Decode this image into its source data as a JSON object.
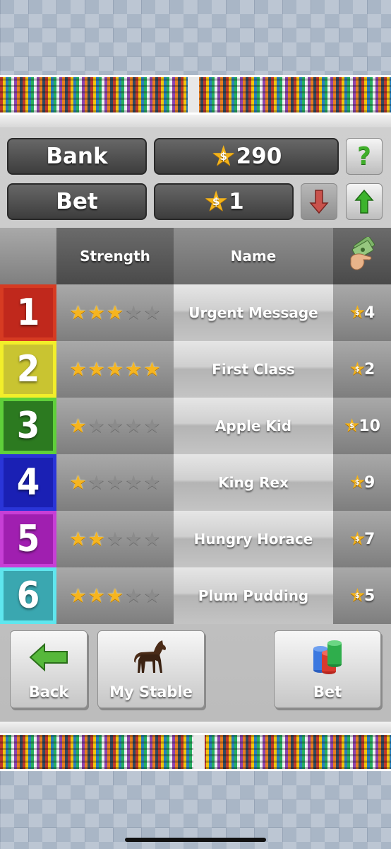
{
  "bank": {
    "label": "Bank",
    "value": "290"
  },
  "bet": {
    "label": "Bet",
    "value": "1"
  },
  "help_label": "?",
  "table": {
    "headers": {
      "strength": "Strength",
      "name": "Name"
    },
    "horses": [
      {
        "number": "1",
        "color": "#c0281c",
        "border": "#d63b22",
        "stars": 3,
        "name": "Urgent Message",
        "odds": "4"
      },
      {
        "number": "2",
        "color": "#c9c431",
        "border": "#f2ee2a",
        "stars": 5,
        "name": "First Class",
        "odds": "2"
      },
      {
        "number": "3",
        "color": "#2c7a20",
        "border": "#5fd03a",
        "stars": 1,
        "name": "Apple Kid",
        "odds": "10"
      },
      {
        "number": "4",
        "color": "#1a20b4",
        "border": "#2a35d8",
        "stars": 1,
        "name": "King Rex",
        "odds": "9"
      },
      {
        "number": "5",
        "color": "#a01fb0",
        "border": "#c73fd6",
        "stars": 2,
        "name": "Hungry Horace",
        "odds": "7"
      },
      {
        "number": "6",
        "color": "#3aa7b0",
        "border": "#5fe6ee",
        "stars": 3,
        "name": "Plum Pudding",
        "odds": "5"
      }
    ]
  },
  "buttons": {
    "back": "Back",
    "stable": "My Stable",
    "bet": "Bet"
  }
}
